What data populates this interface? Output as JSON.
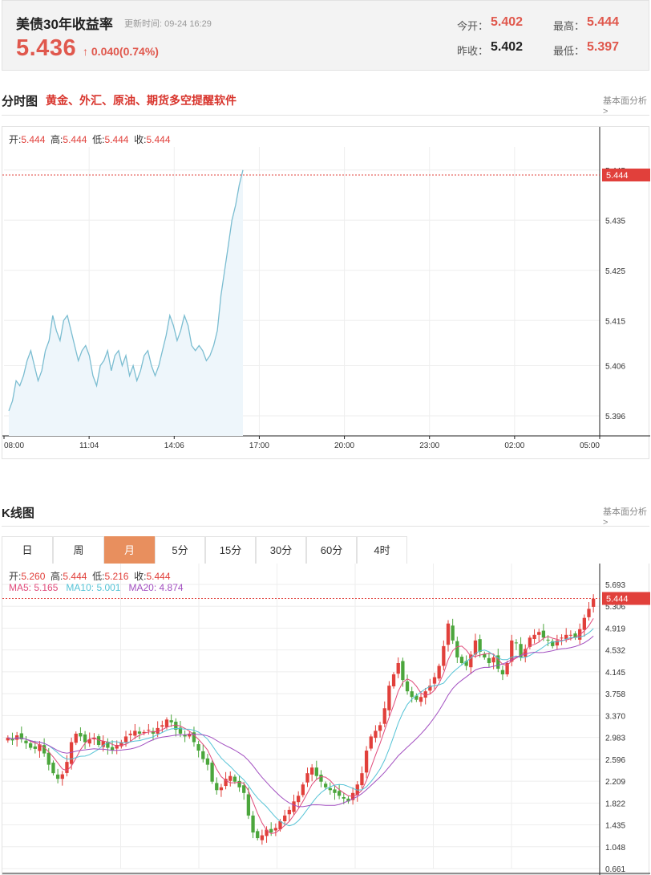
{
  "header": {
    "title": "美债30年收益率",
    "update_label": "更新时间:",
    "update_time": "09-24 16:29",
    "price": "5.436",
    "change_arrow": "↑",
    "change": "0.040(0.74%)",
    "today_open_label": "今开：",
    "today_open": "5.402",
    "prev_close_label": "昨收：",
    "prev_close": "5.402",
    "high_label": "最高：",
    "high": "5.444",
    "low_label": "最低：",
    "low": "5.397"
  },
  "intraday": {
    "title": "分时图",
    "promo": "黄金、外汇、原油、期货多空提醒软件",
    "more": "基本面分析>",
    "ohlc": {
      "open_label": "开:",
      "open": "5.444",
      "high_label": "高:",
      "high": "5.444",
      "low_label": "低:",
      "low": "5.444",
      "close_label": "收:",
      "close": "5.444"
    },
    "y_ticks": [
      "5.445",
      "5.435",
      "5.425",
      "5.415",
      "5.406",
      "5.396"
    ],
    "x_ticks": [
      "08:00",
      "11:04",
      "14:06",
      "17:00",
      "20:00",
      "23:00",
      "02:00",
      "05:00"
    ],
    "last_price_tag": "5.444",
    "line_color": "#7bbdd1",
    "fill_color": "#eef6fb"
  },
  "kline": {
    "title": "K线图",
    "more": "基本面分析>",
    "tabs": [
      "日",
      "周",
      "月",
      "5分",
      "15分",
      "30分",
      "60分",
      "4时"
    ],
    "active_tab": "月",
    "ohlc": {
      "open_label": "开:",
      "open": "5.260",
      "high_label": "高:",
      "high": "5.444",
      "low_label": "低:",
      "low": "5.216",
      "close_label": "收:",
      "close": "5.444"
    },
    "ma": {
      "ma5_label": "MA5:",
      "ma5": "5.165",
      "ma10_label": "MA10:",
      "ma10": "5.001",
      "ma20_label": "MA20:",
      "ma20": "4.874"
    },
    "y_ticks": [
      "5.693",
      "5.306",
      "4.919",
      "4.532",
      "4.145",
      "3.758",
      "3.370",
      "2.983",
      "2.596",
      "2.209",
      "1.822",
      "1.435",
      "1.048",
      "0.661"
    ],
    "last_price_tag": "5.444",
    "colors": {
      "up": "#e1403b",
      "down": "#4ba63c",
      "ma5": "#e04a7a",
      "ma10": "#55c3d6",
      "ma20": "#a24fc0"
    }
  },
  "chart_data": [
    {
      "type": "line",
      "title": "分时图",
      "ylim": [
        5.392,
        5.448
      ],
      "x_ticks": [
        "08:00",
        "11:04",
        "14:06",
        "17:00",
        "20:00",
        "23:00",
        "02:00",
        "05:00"
      ],
      "series": [
        {
          "name": "",
          "values": [
            5.397,
            5.399,
            5.403,
            5.402,
            5.404,
            5.407,
            5.409,
            5.406,
            5.403,
            5.405,
            5.409,
            5.411,
            5.416,
            5.413,
            5.411,
            5.415,
            5.416,
            5.413,
            5.41,
            5.407,
            5.409,
            5.41,
            5.408,
            5.404,
            5.402,
            5.406,
            5.407,
            5.409,
            5.405,
            5.408,
            5.409,
            5.406,
            5.408,
            5.404,
            5.406,
            5.403,
            5.405,
            5.408,
            5.409,
            5.406,
            5.404,
            5.406,
            5.409,
            5.412,
            5.416,
            5.414,
            5.411,
            5.413,
            5.416,
            5.414,
            5.41,
            5.409,
            5.41,
            5.409,
            5.407,
            5.408,
            5.41,
            5.413,
            5.42,
            5.425,
            5.43,
            5.435,
            5.438,
            5.442,
            5.445
          ]
        }
      ]
    },
    {
      "type": "candlestick",
      "title": "K线图",
      "ylim": [
        0.661,
        5.693
      ],
      "ma": {
        "MA5": 5.165,
        "MA10": 5.001,
        "MA20": 4.874
      },
      "series": [
        {
          "name": "",
          "closes": [
            2.98,
            2.93,
            3.02,
            2.95,
            2.88,
            2.8,
            2.78,
            2.86,
            2.7,
            2.5,
            2.35,
            2.25,
            2.33,
            2.55,
            2.9,
            3.05,
            3.0,
            2.9,
            2.95,
            2.98,
            2.85,
            2.92,
            2.8,
            2.75,
            2.85,
            2.9,
            3.0,
            3.05,
            3.1,
            3.05,
            3.08,
            3.12,
            3.05,
            3.15,
            3.2,
            3.3,
            3.25,
            3.12,
            3.05,
            3.0,
            3.05,
            2.9,
            2.75,
            2.6,
            2.5,
            2.2,
            2.05,
            2.1,
            2.25,
            2.3,
            2.2,
            2.1,
            2.0,
            1.6,
            1.3,
            1.2,
            1.25,
            1.35,
            1.3,
            1.38,
            1.5,
            1.6,
            1.7,
            1.85,
            1.95,
            2.15,
            2.35,
            2.45,
            2.3,
            2.2,
            2.1,
            2.05,
            2.0,
            1.95,
            1.9,
            1.85,
            2.0,
            2.15,
            2.35,
            2.75,
            3.0,
            3.1,
            3.2,
            3.5,
            3.9,
            4.1,
            4.3,
            4.0,
            3.8,
            3.7,
            3.65,
            3.7,
            3.8,
            3.9,
            4.05,
            4.25,
            4.6,
            5.0,
            4.7,
            4.4,
            4.3,
            4.25,
            4.45,
            4.7,
            4.5,
            4.4,
            4.3,
            4.4,
            4.2,
            4.1,
            4.3,
            4.7,
            4.65,
            4.4,
            4.55,
            4.75,
            4.8,
            4.85,
            4.75,
            4.7,
            4.6,
            4.7,
            4.75,
            4.8,
            4.8,
            4.75,
            4.9,
            5.1,
            5.26,
            5.44
          ]
        }
      ]
    }
  ]
}
